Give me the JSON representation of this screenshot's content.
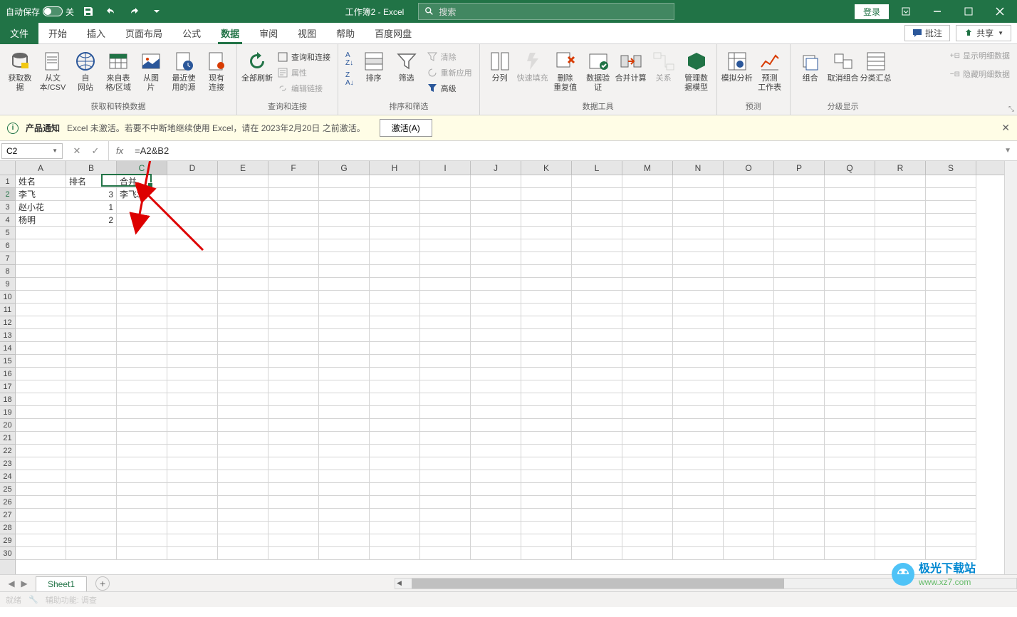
{
  "titlebar": {
    "autosave_label": "自动保存",
    "autosave_state": "关",
    "doc_title": "工作簿2 - Excel",
    "search_placeholder": "搜索",
    "login": "登录"
  },
  "tabs": {
    "file": "文件",
    "items": [
      "开始",
      "插入",
      "页面布局",
      "公式",
      "数据",
      "审阅",
      "视图",
      "帮助",
      "百度网盘"
    ],
    "active_index": 4,
    "comments": "批注",
    "share": "共享"
  },
  "ribbon": {
    "group_get_transform": {
      "label": "获取和转换数据",
      "get_data": "获取数\n据",
      "from_csv": "从文\n本/CSV",
      "from_web": "自\n网站",
      "from_table": "来自表\n格/区域",
      "from_pic": "从图\n片",
      "recent": "最近使\n用的源",
      "existing_conn": "现有\n连接"
    },
    "group_queries": {
      "label": "查询和连接",
      "refresh_all": "全部刷新",
      "queries_conn": "查询和连接",
      "properties": "属性",
      "edit_links": "编辑链接"
    },
    "group_sort_filter": {
      "label": "排序和筛选",
      "sort_asc": "A↓Z",
      "sort_desc": "Z↓A",
      "sort": "排序",
      "filter": "筛选",
      "clear": "清除",
      "reapply": "重新应用",
      "advanced": "高级"
    },
    "group_data_tools": {
      "label": "数据工具",
      "text_to_cols": "分列",
      "flash_fill": "快速填充",
      "remove_dup": "删除\n重复值",
      "data_val": "数据验\n证",
      "consolidate": "合并计算",
      "relations": "关系",
      "data_model": "管理数\n据模型"
    },
    "group_forecast": {
      "label": "预测",
      "whatif": "模拟分析",
      "forecast_sheet": "预测\n工作表"
    },
    "group_outline": {
      "label": "分级显示",
      "group": "组合",
      "ungroup": "取消组合",
      "subtotal": "分类汇总",
      "show_detail": "显示明细数据",
      "hide_detail": "隐藏明细数据"
    }
  },
  "notification": {
    "title": "产品通知",
    "message": "Excel 未激活。若要不中断地继续使用 Excel，请在 2023年2月20日 之前激活。",
    "activate_btn": "激活(A)"
  },
  "formula_bar": {
    "cell_ref": "C2",
    "formula": "=A2&B2"
  },
  "grid": {
    "columns": [
      "A",
      "B",
      "C",
      "D",
      "E",
      "F",
      "G",
      "H",
      "I",
      "J",
      "K",
      "L",
      "M",
      "N",
      "O",
      "P",
      "Q",
      "R",
      "S"
    ],
    "selected_col": "C",
    "selected_row": 2,
    "data": [
      {
        "A": "姓名",
        "B": "排名",
        "C": "合并"
      },
      {
        "A": "李飞",
        "B": "3",
        "C": "李飞3"
      },
      {
        "A": "赵小花",
        "B": "1",
        "C": ""
      },
      {
        "A": "杨明",
        "B": "2",
        "C": ""
      }
    ],
    "total_rows": 30
  },
  "sheet_tabs": {
    "active": "Sheet1"
  },
  "status_bar": {
    "ready": "就绪",
    "accessibility": "辅助功能: 调查"
  },
  "watermark": {
    "text1": "极光下载站",
    "text2": "www.xz7.com"
  }
}
